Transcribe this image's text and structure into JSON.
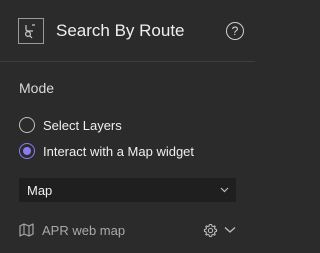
{
  "header": {
    "title": "Search By Route",
    "icon": "route-search-icon",
    "help_icon": "question-circle-icon",
    "help_glyph": "?"
  },
  "mode": {
    "label": "Mode",
    "options": [
      {
        "label": "Select Layers",
        "checked": false
      },
      {
        "label": "Interact with a Map widget",
        "checked": true
      }
    ]
  },
  "map_select": {
    "value": "Map",
    "icon": "chevron-down-icon"
  },
  "map_item": {
    "name": "APR web map",
    "icon": "map-icon",
    "settings_icon": "gear-icon",
    "expand_icon": "chevron-down-icon"
  },
  "colors": {
    "background": "#2b2b2b",
    "accent": "#8b7cf6",
    "select_bg": "#1f1f1f"
  }
}
